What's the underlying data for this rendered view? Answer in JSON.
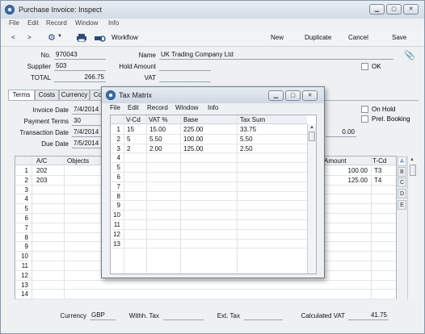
{
  "window": {
    "title": "Purchase Invoice: Inspect"
  },
  "menu": [
    "File",
    "Edit",
    "Record",
    "Window",
    "Info"
  ],
  "toolbar": {
    "back": "<",
    "forward": ">",
    "workflow": "Workflow",
    "new": "New",
    "duplicate": "Duplicate",
    "cancel": "Cancel",
    "save": "Save"
  },
  "header": {
    "no_label": "No.",
    "no_value": "970043",
    "name_label": "Name",
    "name_value": "UK Trading Company Ltd",
    "supplier_label": "Supplier",
    "supplier_value": "503",
    "hold_label": "Hold Amount",
    "hold_value": "",
    "ok_label": "OK",
    "total_label": "TOTAL",
    "total_value": "266.75",
    "vat_label": "VAT",
    "vat_value": ""
  },
  "tabs": [
    "Terms",
    "Costs",
    "Currency",
    "Co"
  ],
  "terms": {
    "invoice_date_label": "Invoice Date",
    "invoice_date": "7/4/2014",
    "payment_terms_label": "Payment Terms",
    "payment_terms": "30",
    "transaction_date_label": "Transaction Date",
    "transaction_date": "7/4/2014",
    "due_date_label": "Due Date",
    "due_date": "7/5/2014",
    "on_hold_label": "On Hold",
    "prel_booking_label": "Prel. Booking",
    "right_value": "0.00"
  },
  "grid": {
    "col_ac": "A/C",
    "col_objects": "Objects",
    "col_amount": "Amount",
    "col_tcd": "T-Cd",
    "rows": [
      {
        "n": "1",
        "ac": "202",
        "amount": "100.00",
        "tcd": "T3"
      },
      {
        "n": "2",
        "ac": "203",
        "amount": "125.00",
        "tcd": "T4"
      },
      {
        "n": "3"
      },
      {
        "n": "4"
      },
      {
        "n": "5"
      },
      {
        "n": "6"
      },
      {
        "n": "7"
      },
      {
        "n": "8"
      },
      {
        "n": "9"
      },
      {
        "n": "10"
      },
      {
        "n": "11"
      },
      {
        "n": "12"
      },
      {
        "n": "13"
      },
      {
        "n": "14"
      }
    ],
    "side_letters": [
      "A",
      "B",
      "C",
      "D",
      "E"
    ]
  },
  "footer": {
    "currency_label": "Currency",
    "currency_value": "GBP",
    "withh_label": "Withh. Tax",
    "withh_value": "",
    "ext_label": "Ext. Tax",
    "ext_value": "",
    "calc_label": "Calculated VAT",
    "calc_value": "41.75"
  },
  "modal": {
    "title": "Tax Matrix",
    "menu": [
      "File",
      "Edit",
      "Record",
      "Window",
      "Info"
    ],
    "columns": [
      "V-Cd",
      "VAT %",
      "Base",
      "Tax Sum"
    ],
    "rows": [
      {
        "n": "1",
        "vcd": "15",
        "vat": "15.00",
        "base": "225.00",
        "sum": "33.75"
      },
      {
        "n": "2",
        "vcd": "5",
        "vat": "5.50",
        "base": "100.00",
        "sum": "5.50"
      },
      {
        "n": "3",
        "vcd": "2",
        "vat": "2.00",
        "base": "125.00",
        "sum": "2.50"
      },
      {
        "n": "4"
      },
      {
        "n": "5"
      },
      {
        "n": "6"
      },
      {
        "n": "7"
      },
      {
        "n": "8"
      },
      {
        "n": "9"
      },
      {
        "n": "10"
      },
      {
        "n": "11"
      },
      {
        "n": "12"
      },
      {
        "n": "13"
      }
    ]
  }
}
